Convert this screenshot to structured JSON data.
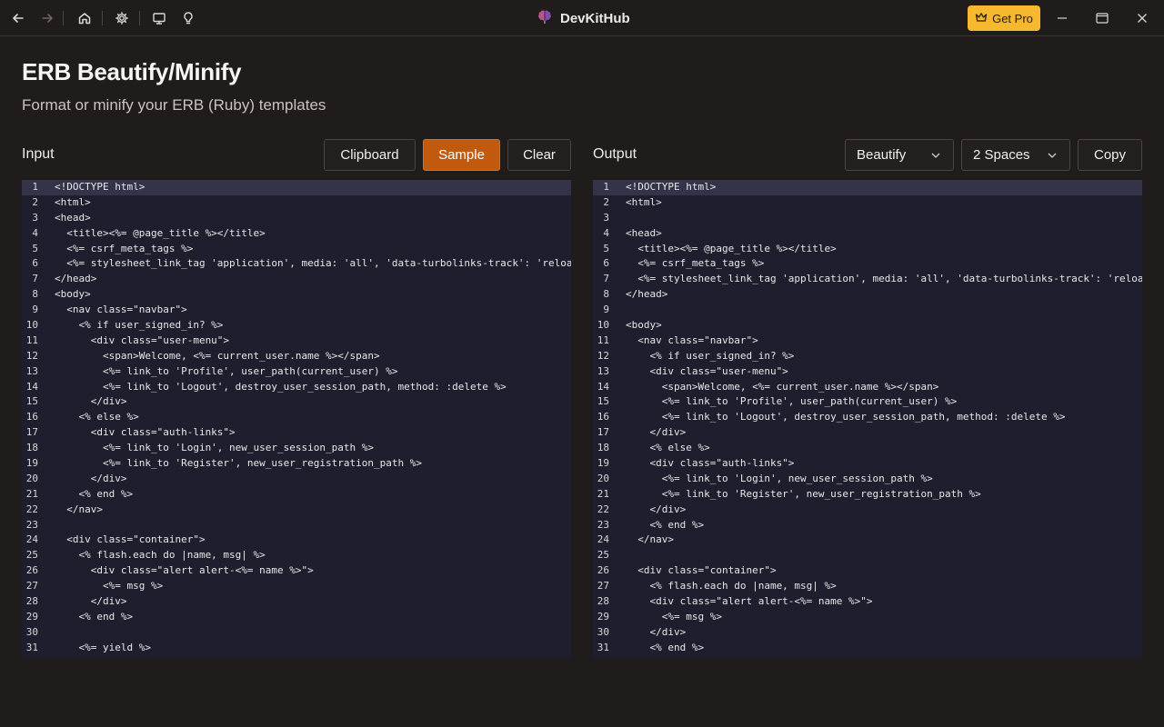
{
  "app": {
    "title": "DevKitHub",
    "get_pro_label": "Get Pro"
  },
  "icons": {
    "back": "arrow-left-icon",
    "forward": "arrow-right-icon",
    "home": "home-icon",
    "settings": "gear-icon",
    "monitor": "monitor-icon",
    "idea": "lightbulb-icon",
    "logo": "brain-logo-icon",
    "crown": "crown-icon"
  },
  "page": {
    "title": "ERB Beautify/Minify",
    "subtitle": "Format or minify your ERB (Ruby) templates"
  },
  "input": {
    "label": "Input",
    "clipboard_label": "Clipboard",
    "sample_label": "Sample",
    "clear_label": "Clear",
    "lines": [
      "<!DOCTYPE html>",
      "<html>",
      "<head>",
      "  <title><%= @page_title %></title>",
      "  <%= csrf_meta_tags %>",
      "  <%= stylesheet_link_tag 'application', media: 'all', 'data-turbolinks-track': 'reload' %>",
      "</head>",
      "<body>",
      "  <nav class=\"navbar\">",
      "    <% if user_signed_in? %>",
      "      <div class=\"user-menu\">",
      "        <span>Welcome, <%= current_user.name %></span>",
      "        <%= link_to 'Profile', user_path(current_user) %>",
      "        <%= link_to 'Logout', destroy_user_session_path, method: :delete %>",
      "      </div>",
      "    <% else %>",
      "      <div class=\"auth-links\">",
      "        <%= link_to 'Login', new_user_session_path %>",
      "        <%= link_to 'Register', new_user_registration_path %>",
      "      </div>",
      "    <% end %>",
      "  </nav>",
      "",
      "  <div class=\"container\">",
      "    <% flash.each do |name, msg| %>",
      "      <div class=\"alert alert-<%= name %>\">",
      "        <%= msg %>",
      "      </div>",
      "    <% end %>",
      "",
      "    <%= yield %>"
    ]
  },
  "output": {
    "label": "Output",
    "mode_value": "Beautify",
    "indent_value": "2 Spaces",
    "copy_label": "Copy",
    "lines": [
      "<!DOCTYPE html>",
      "<html>",
      "",
      "<head>",
      "  <title><%= @page_title %></title>",
      "  <%= csrf_meta_tags %>",
      "  <%= stylesheet_link_tag 'application', media: 'all', 'data-turbolinks-track': 'reload' %>",
      "</head>",
      "",
      "<body>",
      "  <nav class=\"navbar\">",
      "    <% if user_signed_in? %>",
      "    <div class=\"user-menu\">",
      "      <span>Welcome, <%= current_user.name %></span>",
      "      <%= link_to 'Profile', user_path(current_user) %>",
      "      <%= link_to 'Logout', destroy_user_session_path, method: :delete %>",
      "    </div>",
      "    <% else %>",
      "    <div class=\"auth-links\">",
      "      <%= link_to 'Login', new_user_session_path %>",
      "      <%= link_to 'Register', new_user_registration_path %>",
      "    </div>",
      "    <% end %>",
      "  </nav>",
      "",
      "  <div class=\"container\">",
      "    <% flash.each do |name, msg| %>",
      "    <div class=\"alert alert-<%= name %>\">",
      "      <%= msg %>",
      "    </div>",
      "    <% end %>"
    ]
  },
  "colors": {
    "accent": "#c25a0e",
    "pro": "#f5b82e",
    "background": "#201c1b",
    "editor_bg": "#1e1e2e",
    "active_line": "#35334a"
  }
}
